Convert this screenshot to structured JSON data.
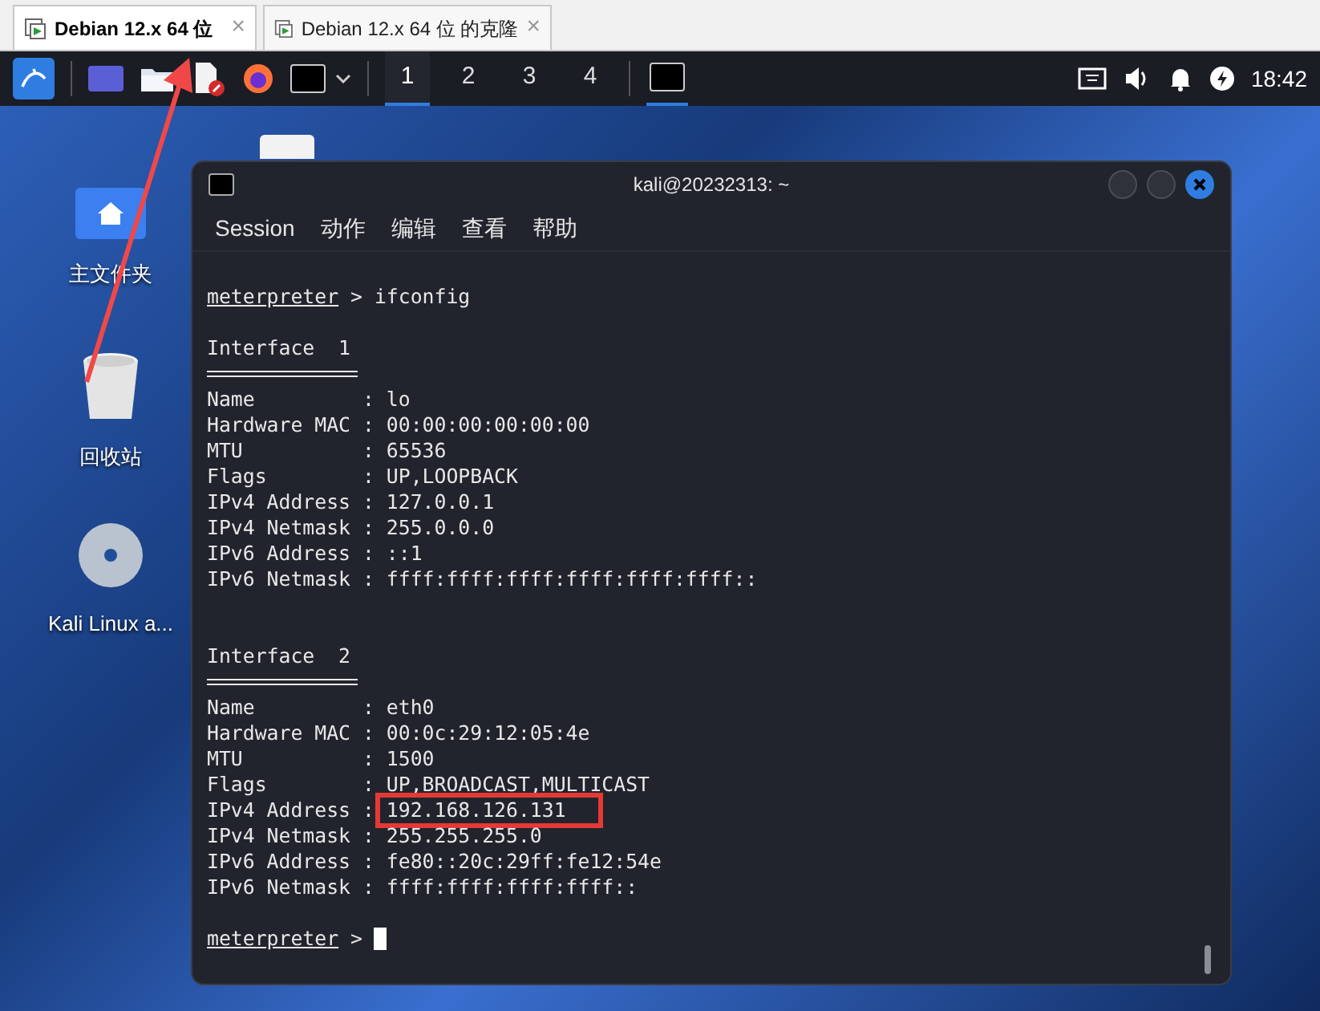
{
  "vm_tabs": [
    {
      "label": "Debian 12.x 64 位",
      "selected": true,
      "close": "×"
    },
    {
      "label": "Debian 12.x 64 位 的克隆",
      "selected": false,
      "close": "×"
    }
  ],
  "taskbar": {
    "workspaces": [
      {
        "label": "1",
        "selected": true
      },
      {
        "label": "2",
        "selected": false
      },
      {
        "label": "3",
        "selected": false
      },
      {
        "label": "4",
        "selected": false
      }
    ],
    "clock": "18:42"
  },
  "desktop_icons": [
    {
      "kind": "home",
      "label": "主文件夹"
    },
    {
      "kind": "trash",
      "label": "回收站"
    },
    {
      "kind": "disc",
      "label": "Kali Linux a..."
    }
  ],
  "terminal": {
    "title": "kali@20232313: ~",
    "menu": [
      "Session",
      "动作",
      "编辑",
      "查看",
      "帮助"
    ],
    "lines": [
      {
        "kind": "blank"
      },
      {
        "kind": "prompt",
        "prompt": "meterpreter",
        "text": " > ifconfig"
      },
      {
        "kind": "blank"
      },
      {
        "kind": "heading",
        "text": "Interface  1"
      },
      {
        "kind": "rule"
      },
      {
        "kind": "field",
        "label": "Name         : ",
        "value": "lo",
        "highlighted": false
      },
      {
        "kind": "field",
        "label": "Hardware MAC : ",
        "value": "00:00:00:00:00:00",
        "highlighted": false
      },
      {
        "kind": "field",
        "label": "MTU          : ",
        "value": "65536",
        "highlighted": false
      },
      {
        "kind": "field",
        "label": "Flags        : ",
        "value": "UP,LOOPBACK",
        "highlighted": false
      },
      {
        "kind": "field",
        "label": "IPv4 Address : ",
        "value": "127.0.0.1",
        "highlighted": false
      },
      {
        "kind": "field",
        "label": "IPv4 Netmask : ",
        "value": "255.0.0.0",
        "highlighted": false
      },
      {
        "kind": "field",
        "label": "IPv6 Address : ",
        "value": "::1",
        "highlighted": false
      },
      {
        "kind": "field",
        "label": "IPv6 Netmask : ",
        "value": "ffff:ffff:ffff:ffff:ffff:ffff::",
        "highlighted": false
      },
      {
        "kind": "blank"
      },
      {
        "kind": "blank"
      },
      {
        "kind": "heading",
        "text": "Interface  2"
      },
      {
        "kind": "rule"
      },
      {
        "kind": "field",
        "label": "Name         : ",
        "value": "eth0",
        "highlighted": false
      },
      {
        "kind": "field",
        "label": "Hardware MAC : ",
        "value": "00:0c:29:12:05:4e",
        "highlighted": false
      },
      {
        "kind": "field",
        "label": "MTU          : ",
        "value": "1500",
        "highlighted": false
      },
      {
        "kind": "field",
        "label": "Flags        : ",
        "value": "UP,BROADCAST,MULTICAST",
        "highlighted": false
      },
      {
        "kind": "field",
        "label": "IPv4 Address : ",
        "value": "192.168.126.131",
        "highlighted": true
      },
      {
        "kind": "field",
        "label": "IPv4 Netmask : ",
        "value": "255.255.255.0",
        "highlighted": false
      },
      {
        "kind": "field",
        "label": "IPv6 Address : ",
        "value": "fe80::20c:29ff:fe12:54e",
        "highlighted": false
      },
      {
        "kind": "field",
        "label": "IPv6 Netmask : ",
        "value": "ffff:ffff:ffff:ffff::",
        "highlighted": false
      },
      {
        "kind": "blank"
      },
      {
        "kind": "prompt",
        "prompt": "meterpreter",
        "text": " > ",
        "cursor": true
      }
    ]
  }
}
